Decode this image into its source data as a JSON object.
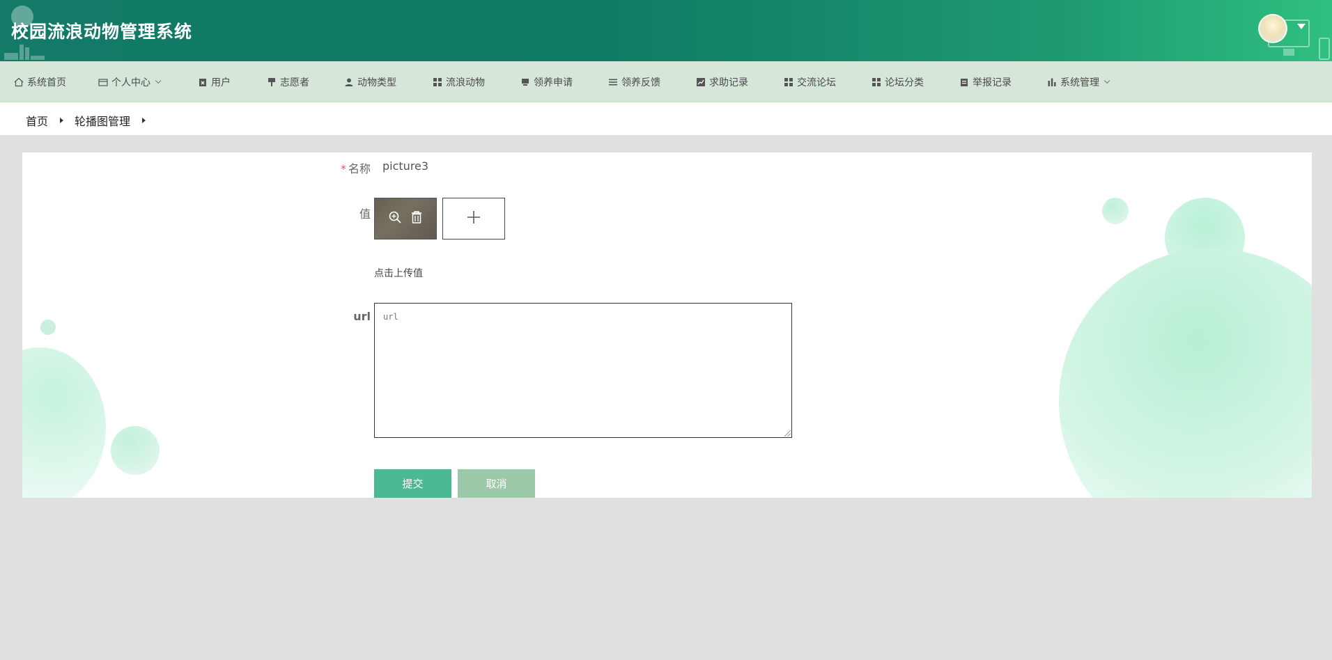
{
  "app": {
    "title": "校园流浪动物管理系统"
  },
  "header": {
    "avatar_icon": "avatar-icon",
    "caret_icon": "caret-down-icon"
  },
  "nav": {
    "items": [
      {
        "label": "系统首页",
        "icon": "home-icon"
      },
      {
        "label": "个人中心",
        "icon": "wallet-icon",
        "dropdown": true
      },
      {
        "label": "用户",
        "icon": "clipboard-x-icon"
      },
      {
        "label": "志愿者",
        "icon": "brush-icon"
      },
      {
        "label": "动物类型",
        "icon": "user-icon"
      },
      {
        "label": "流浪动物",
        "icon": "grid-icon"
      },
      {
        "label": "领养申请",
        "icon": "inbox-icon"
      },
      {
        "label": "领养反馈",
        "icon": "menu-icon"
      },
      {
        "label": "求助记录",
        "icon": "chart-line-icon"
      },
      {
        "label": "交流论坛",
        "icon": "grid-icon"
      },
      {
        "label": "论坛分类",
        "icon": "grid-icon"
      },
      {
        "label": "举报记录",
        "icon": "clipboard-icon"
      },
      {
        "label": "系统管理",
        "icon": "bar-chart-icon",
        "dropdown": true
      }
    ]
  },
  "breadcrumb": {
    "items": [
      "首页",
      "轮播图管理"
    ]
  },
  "form": {
    "name_label": "名称",
    "name_required_mark": "*",
    "name_value": "picture3",
    "value_label": "值",
    "upload_hint": "点击上传值",
    "url_label": "url",
    "url_placeholder": "url",
    "url_value": "",
    "submit_label": "提交",
    "cancel_label": "取消"
  },
  "colors": {
    "header_start": "#127a66",
    "header_end": "#2fbf80",
    "nav_bg": "#d6e7d9",
    "submit": "#4cb993",
    "cancel": "#9cc9a9",
    "required": "#e05a5a"
  }
}
